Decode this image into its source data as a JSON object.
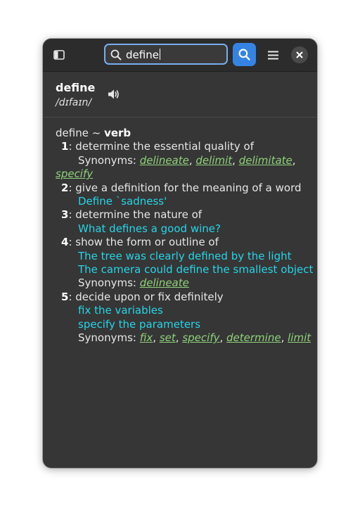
{
  "search": {
    "value": "define"
  },
  "word": {
    "term": "define",
    "pronunciation": "/dɪfaɪn/"
  },
  "entry": {
    "word": "define",
    "separator": "~",
    "part_of_speech": "verb",
    "senses": [
      {
        "num": "1",
        "definition": ": determine the essential quality of",
        "synonyms_label": "Synonyms:",
        "synonyms": [
          "delineate",
          "delimit",
          "delimitate",
          "specify"
        ]
      },
      {
        "num": "2",
        "definition": ": give a definition for the meaning of a word",
        "examples": [
          "Define `sadness'"
        ]
      },
      {
        "num": "3",
        "definition": ": determine the nature of",
        "examples": [
          "What defines a good wine?"
        ]
      },
      {
        "num": "4",
        "definition": ": show the form or outline of",
        "examples": [
          "The tree was clearly defined by the light",
          "The camera could define the smallest object"
        ],
        "synonyms_label": "Synonyms:",
        "synonyms": [
          "delineate"
        ]
      },
      {
        "num": "5",
        "definition": ": decide upon or fix definitely",
        "examples": [
          "fix the variables",
          "specify the parameters"
        ],
        "synonyms_label": "Synonyms:",
        "synonyms": [
          "fix",
          "set",
          "specify",
          "determine",
          "limit"
        ]
      }
    ]
  },
  "icons": {
    "sidebar": "sidebar-toggle-icon",
    "search": "search-icon",
    "menu": "hamburger-menu-icon",
    "close": "close-icon",
    "speaker": "speaker-icon"
  },
  "colors": {
    "accent": "#3584e4",
    "example": "#27d4e8",
    "synonym": "#8fd17a",
    "window": "#363636",
    "headerbar": "#2c2c2c"
  }
}
